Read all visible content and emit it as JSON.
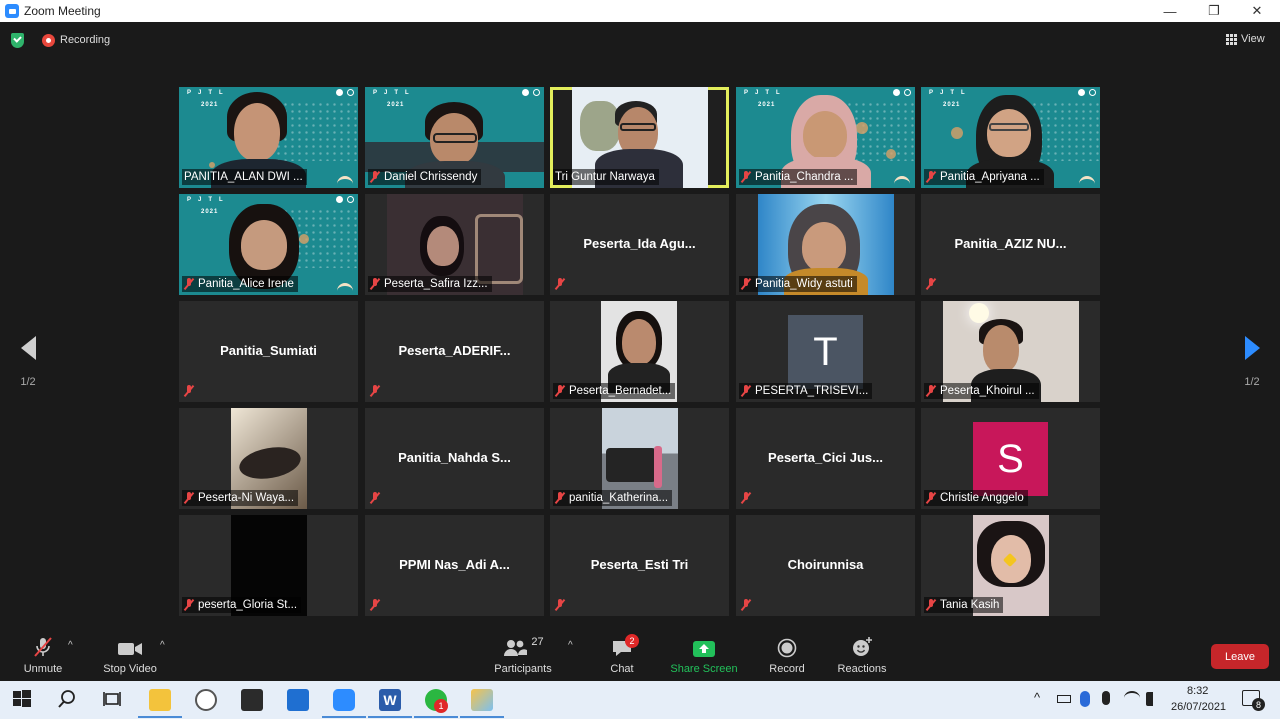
{
  "window": {
    "title": "Zoom Meeting"
  },
  "topbar": {
    "recording_label": "Recording",
    "view_label": "View"
  },
  "paging": {
    "left_label": "1/2",
    "right_label": "1/2"
  },
  "tiles": [
    {
      "name": "PANITIA_ALAN DWI ...",
      "big": ""
    },
    {
      "name": "Daniel Chrissendy",
      "big": ""
    },
    {
      "name": "Tri Guntur Narwaya",
      "big": ""
    },
    {
      "name": "Panitia_Chandra ...",
      "big": ""
    },
    {
      "name": "Panitia_Apriyana ...",
      "big": ""
    },
    {
      "name": "Panitia_Alice Irene",
      "big": ""
    },
    {
      "name": "Peserta_Safira Izz...",
      "big": ""
    },
    {
      "name": "",
      "big": "Peserta_Ida  Agu..."
    },
    {
      "name": "Panitia_Widy astuti",
      "big": ""
    },
    {
      "name": "",
      "big": "Panitia_AZIZ  NU..."
    },
    {
      "name": "",
      "big": "Panitia_Sumiati"
    },
    {
      "name": "",
      "big": "Peserta_ADERIF..."
    },
    {
      "name": "Peserta_Bernadet...",
      "big": ""
    },
    {
      "name": "PESERTA_TRISEVI...",
      "big": "",
      "avatar": "T"
    },
    {
      "name": "Peserta_Khoirul ...",
      "big": ""
    },
    {
      "name": "Peserta-Ni Waya...",
      "big": ""
    },
    {
      "name": "",
      "big": "Panitia_Nahda  S..."
    },
    {
      "name": "panitia_Katherina...",
      "big": ""
    },
    {
      "name": "",
      "big": "Peserta_Cici  Jus..."
    },
    {
      "name": "Christie Anggelo",
      "big": "",
      "avatar": "S"
    },
    {
      "name": "peserta_Gloria St...",
      "big": ""
    },
    {
      "name": "",
      "big": "PPMI  Nas_Adi  A..."
    },
    {
      "name": "",
      "big": "Peserta_Esti Tri"
    },
    {
      "name": "",
      "big": "Choirunnisa"
    },
    {
      "name": "Tania Kasih",
      "big": ""
    }
  ],
  "teal_brand": {
    "letters": "PJTL",
    "year": "2021"
  },
  "toolbar": {
    "unmute": "Unmute",
    "stop_video": "Stop Video",
    "participants": "Participants",
    "participants_count": "27",
    "chat": "Chat",
    "chat_badge": "2",
    "share_screen": "Share Screen",
    "record": "Record",
    "reactions": "Reactions",
    "leave": "Leave"
  },
  "taskbar": {
    "time": "8:32",
    "date": "26/07/2021",
    "whatsapp_badge": "1",
    "notification_count": "8"
  },
  "colors": {
    "accent": "#2d8cff",
    "leave": "#c6262a",
    "share": "#22c05a",
    "active_speaker": "#e3ee5c",
    "teal_bg": "#1c8a90"
  }
}
